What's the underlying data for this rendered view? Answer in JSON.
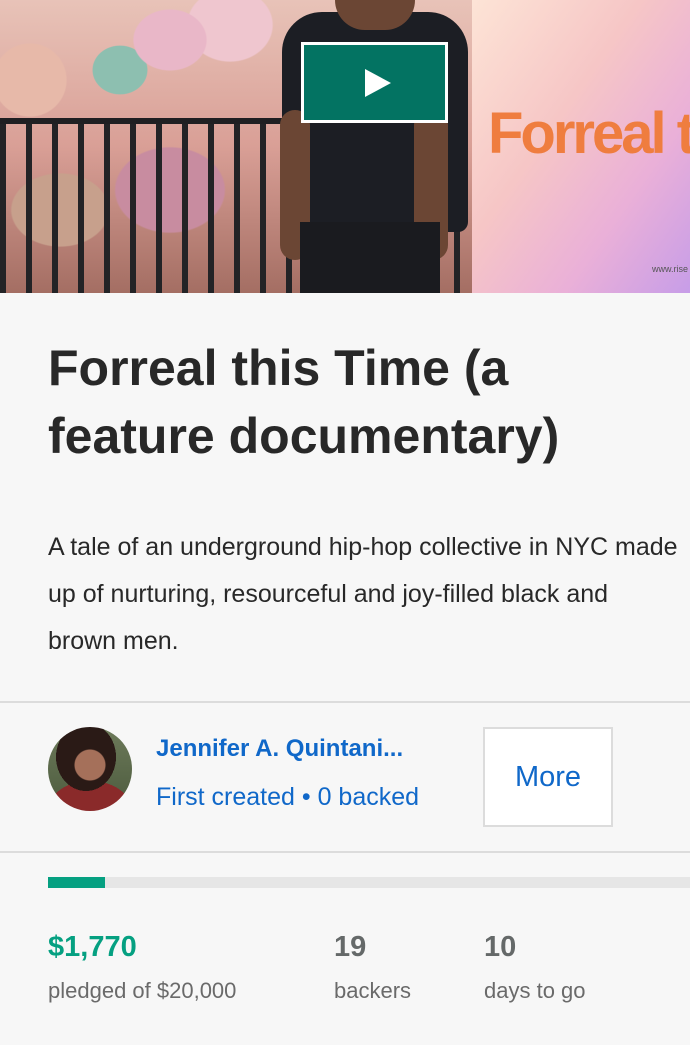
{
  "hero": {
    "play_icon": "play-icon",
    "poster_title": "Forreal this Tim",
    "poster_url": "www.rise"
  },
  "project": {
    "title": "Forreal this Time (a feature documentary)",
    "blurb": "A tale of an underground hip-hop collective in NYC made up of nurturing, resourceful and joy-filled black and brown men."
  },
  "creator": {
    "name": "Jennifer A. Quintani...",
    "meta": "First created • 0 backed",
    "more_label": "More"
  },
  "funding": {
    "progress_fraction": 0.0885,
    "pledged": "$1,770",
    "pledged_label": "pledged of $20,000",
    "backers": "19",
    "backers_label": "backers",
    "days": "10",
    "days_label": "days to go"
  },
  "colors": {
    "accent_green": "#05a081",
    "link_blue": "#1068c9",
    "play_button": "#037362"
  }
}
